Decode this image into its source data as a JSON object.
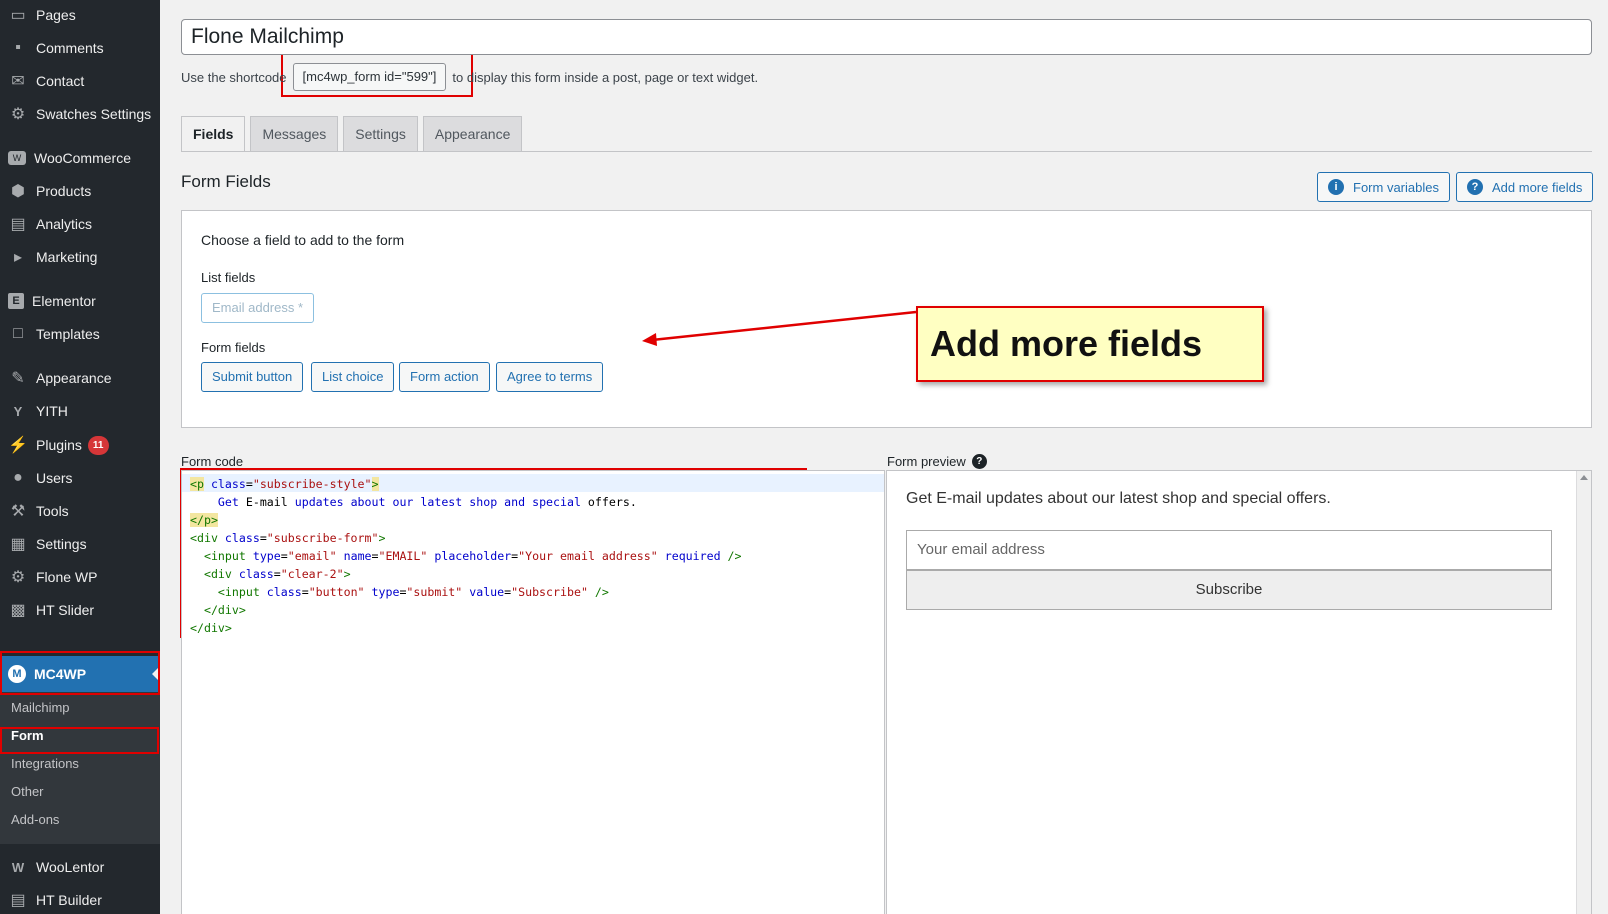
{
  "sidebar": {
    "items": [
      {
        "label": "Pages",
        "icon": "pages-icon"
      },
      {
        "label": "Comments",
        "icon": "comments-icon"
      },
      {
        "label": "Contact",
        "icon": "envelope-icon"
      },
      {
        "label": "Swatches Settings",
        "icon": "gear-icon"
      },
      {
        "label": "WooCommerce",
        "icon": "woocommerce-icon"
      },
      {
        "label": "Products",
        "icon": "box-icon"
      },
      {
        "label": "Analytics",
        "icon": "bar-chart-icon"
      },
      {
        "label": "Marketing",
        "icon": "megaphone-icon"
      },
      {
        "label": "Elementor",
        "icon": "elementor-icon"
      },
      {
        "label": "Templates",
        "icon": "folder-icon"
      },
      {
        "label": "Appearance",
        "icon": "brush-icon"
      },
      {
        "label": "YITH",
        "icon": "yith-icon"
      },
      {
        "label": "Plugins",
        "icon": "plug-icon",
        "badge": "11"
      },
      {
        "label": "Users",
        "icon": "user-icon"
      },
      {
        "label": "Tools",
        "icon": "wrench-icon"
      },
      {
        "label": "Settings",
        "icon": "settings-icon"
      },
      {
        "label": "Flone WP",
        "icon": "gear-icon"
      },
      {
        "label": "HT Slider",
        "icon": "slider-icon"
      },
      {
        "label": "MC4WP",
        "icon": "mc4wp-icon"
      },
      {
        "label": "WooLentor",
        "icon": "woolentor-icon"
      },
      {
        "label": "HT Builder",
        "icon": "document-icon"
      }
    ],
    "submenu": [
      "Mailchimp",
      "Form",
      "Integrations",
      "Other",
      "Add-ons"
    ]
  },
  "form": {
    "title": "Flone Mailchimp",
    "shortcode_prefix": "Use the shortcode",
    "shortcode": "[mc4wp_form id=\"599\"]",
    "shortcode_suffix": "to display this form inside a post, page or text widget."
  },
  "tabs": [
    "Fields",
    "Messages",
    "Settings",
    "Appearance"
  ],
  "fields": {
    "section_title": "Form Fields",
    "form_variables_label": "Form variables",
    "add_more_fields_label": "Add more fields",
    "choose_label": "Choose a field to add to the form",
    "list_fields_label": "List fields",
    "email_button": "Email address *",
    "form_fields_label": "Form fields",
    "buttons": [
      "Submit button",
      "List choice",
      "Form action",
      "Agree to terms"
    ]
  },
  "callout": {
    "text": "Add more fields"
  },
  "code": {
    "label": "Form code",
    "lines": [
      "<p class=\"subscribe-style\">",
      "    Get E-mail updates about our latest shop and special offers.",
      "</p>",
      "<div class=\"subscribe-form\">",
      "  <input type=\"email\" name=\"EMAIL\" placeholder=\"Your email address\" required />",
      "  <div class=\"clear-2\">",
      "    <input class=\"button\" type=\"submit\" value=\"Subscribe\" />",
      "  </div>",
      "</div>"
    ]
  },
  "preview": {
    "label": "Form preview",
    "text": "Get E-mail updates about our latest shop and special offers.",
    "email_placeholder": "Your email address",
    "submit": "Subscribe"
  },
  "colors": {
    "sidebar_bg": "#23282d",
    "accent": "#2271b1",
    "highlight": "#e00000",
    "callout_bg": "#ffffc2"
  }
}
